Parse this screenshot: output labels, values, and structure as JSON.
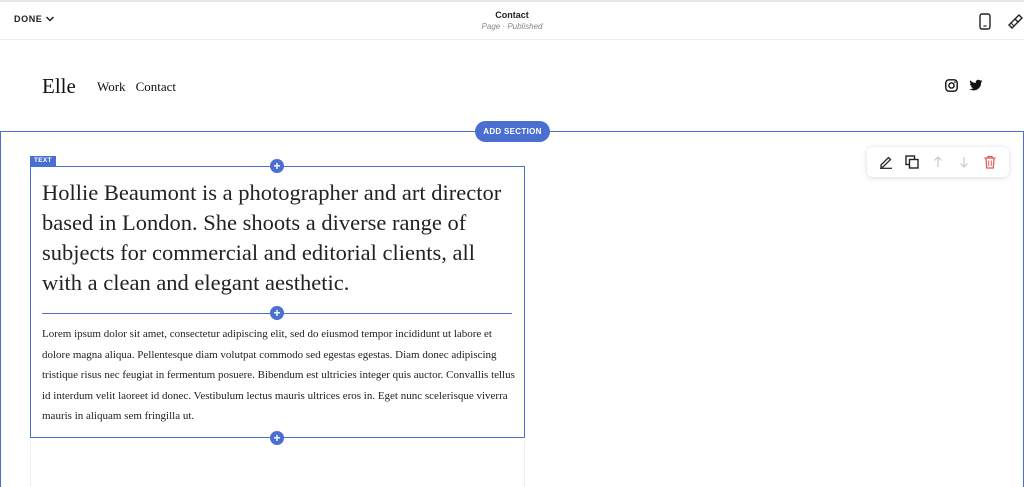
{
  "topbar": {
    "done_label": "DONE",
    "page_title": "Contact",
    "page_status": "Page · Published"
  },
  "site": {
    "logo": "Elle",
    "nav": [
      "Work",
      "Contact"
    ]
  },
  "editor": {
    "add_section_label": "ADD SECTION",
    "block_tag": "TEXT"
  },
  "content": {
    "heading": "Hollie Beaumont is a photographer and art director based in London. She shoots a diverse range of subjects for commercial and editorial clients, all with a clean and elegant aesthetic.",
    "body": "Lorem ipsum dolor sit amet, consectetur adipiscing elit, sed do eiusmod tempor incididunt ut labore et dolore magna aliqua. Pellentesque diam volutpat commodo sed egestas egestas. Diam donec adipiscing tristique risus nec feugiat in fermentum posuere. Bibendum est ultricies integer quis auctor. Convallis tellus id interdum velit laoreet id donec. Vestibulum lectus mauris ultrices eros in. Eget nunc scelerisque viverra mauris in aliquam sem fringilla ut."
  },
  "colors": {
    "accent": "#4a6fd1",
    "delete": "#e05a5a"
  }
}
